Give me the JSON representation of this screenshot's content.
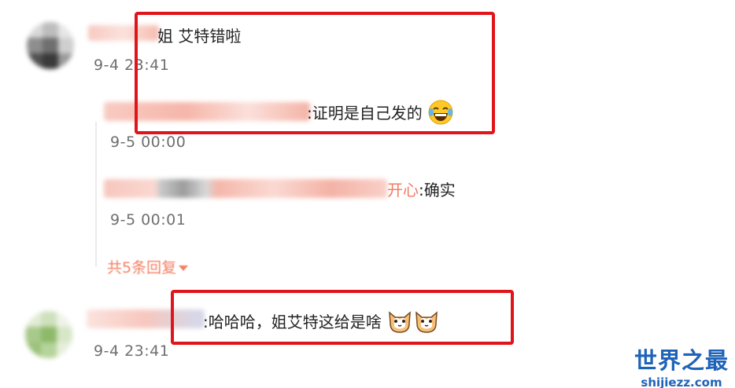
{
  "comments": [
    {
      "text": "姐 艾特错啦",
      "time": "9-4 23:41",
      "replies": [
        {
          "text": ":证明是自己发的",
          "emoji": "laugh-cry-emoji",
          "time": "9-5 00:00"
        },
        {
          "name_suffix": "开心",
          "text": ":确实",
          "time": "9-5 00:01"
        }
      ],
      "more_replies": "共5条回复"
    },
    {
      "text": ":哈哈哈，姐艾特这给是啥",
      "emoji": "cat-face-emoji",
      "time": "9-4 23:41"
    }
  ],
  "watermark": {
    "title": "世界之最",
    "url": "shijiezz.com"
  },
  "colors": {
    "highlight_box": "#e0141b",
    "link": "#f27a62",
    "watermark": "#1e63b8"
  }
}
